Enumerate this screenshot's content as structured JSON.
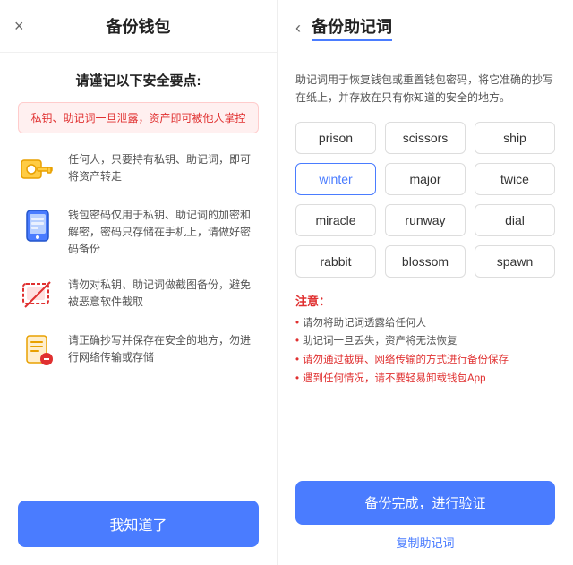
{
  "left": {
    "title": "备份钱包",
    "close_icon": "×",
    "safety_title": "请谨记以下安全要点:",
    "warning": "私钥、助记词一旦泄露，资产即可被他人掌控",
    "items": [
      {
        "icon": "🔑",
        "text": "任何人，只要持有私钥、助记词，即可将资产转走"
      },
      {
        "icon": "📱",
        "text": "钱包密码仅用于私钥、助记词的加密和解密，密码只存储在手机上，请做好密码备份"
      },
      {
        "icon": "📷",
        "text": "请勿对私钥、助记词做截图备份，避免被恶意软件截取"
      },
      {
        "icon": "📄",
        "text": "请正确抄写并保存在安全的地方，勿进行网络传输或存储"
      }
    ],
    "button_label": "我知道了"
  },
  "right": {
    "back_icon": "‹",
    "title": "备份助记词",
    "description": "助记词用于恢复钱包或重置钱包密码，将它准确的抄写在纸上，并存放在只有你知道的安全的地方。",
    "words": [
      {
        "word": "prison",
        "highlighted": false
      },
      {
        "word": "scissors",
        "highlighted": false
      },
      {
        "word": "ship",
        "highlighted": false
      },
      {
        "word": "winter",
        "highlighted": true
      },
      {
        "word": "major",
        "highlighted": false
      },
      {
        "word": "twice",
        "highlighted": false
      },
      {
        "word": "miracle",
        "highlighted": false
      },
      {
        "word": "runway",
        "highlighted": false
      },
      {
        "word": "dial",
        "highlighted": false
      },
      {
        "word": "rabbit",
        "highlighted": false
      },
      {
        "word": "blossom",
        "highlighted": false
      },
      {
        "word": "spawn",
        "highlighted": false
      }
    ],
    "notes_title": "注意：",
    "notes": [
      {
        "text": "请勿将助记词透露给任何人",
        "red": false
      },
      {
        "text": "助记词一旦丢失，资产将无法恢复",
        "red": false
      },
      {
        "text": "请勿通过截屏、网络传输的方式进行备份保存",
        "red": true
      },
      {
        "text": "遇到任何情况，请不要轻易卸载钱包App",
        "red": true
      }
    ],
    "verify_button": "备份完成，进行验证",
    "copy_link": "复制助记词"
  }
}
